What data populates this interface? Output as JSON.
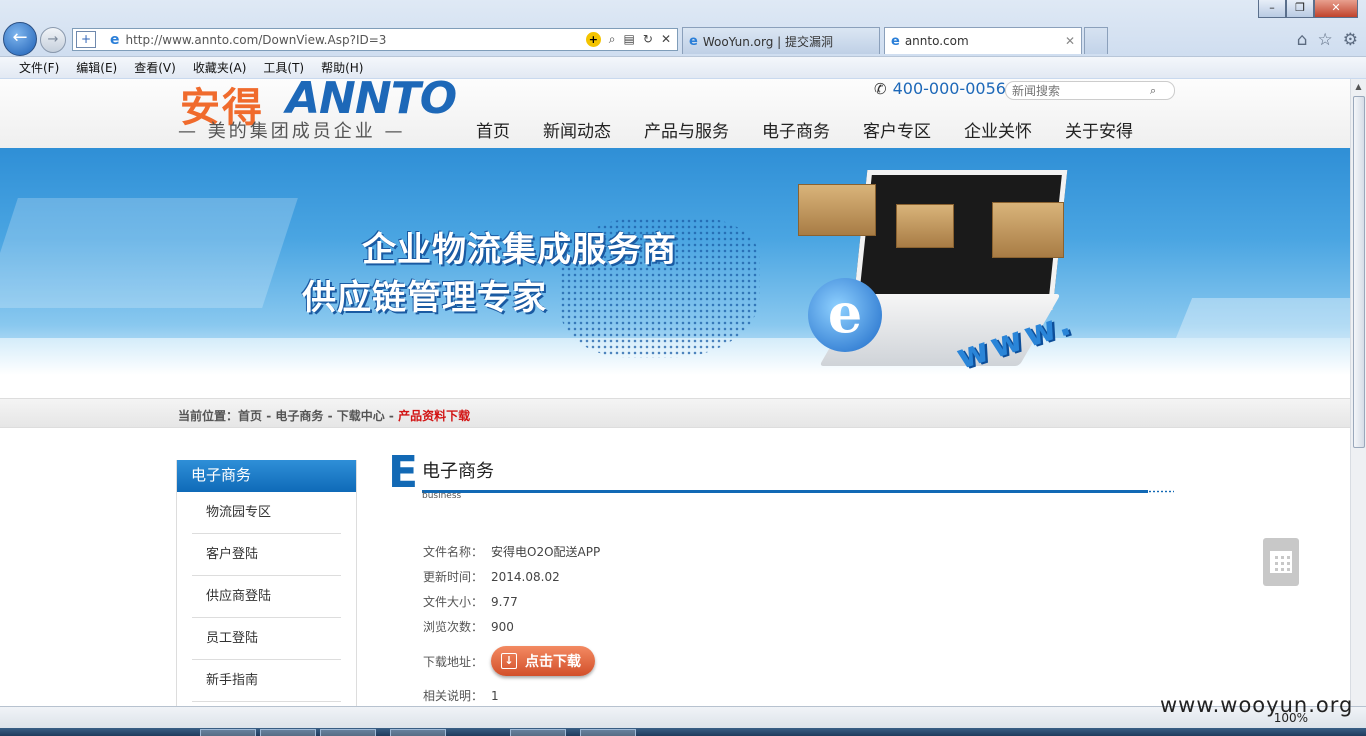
{
  "browser": {
    "url": "http://www.annto.com/DownView.Asp?ID=3",
    "tabs": [
      {
        "label": "WooYun.org | 提交漏洞"
      },
      {
        "label": "annto.com"
      }
    ],
    "menu": [
      "文件(F)",
      "编辑(E)",
      "查看(V)",
      "收藏夹(A)",
      "工具(T)",
      "帮助(H)"
    ],
    "zoom": "100%",
    "icons": [
      "back-icon",
      "forward-icon",
      "refresh-icon",
      "search-icon",
      "home-icon",
      "star-icon",
      "gear-icon"
    ]
  },
  "header": {
    "logo_cn": "安得",
    "logo_en": "ANNTO",
    "logo_tagline": "— 美的集团成员企业 —",
    "phone": "400-000-0056",
    "search_placeholder": "新闻搜索",
    "nav": [
      "首页",
      "新闻动态",
      "产品与服务",
      "电子商务",
      "客户专区",
      "企业关怀",
      "关于安得"
    ]
  },
  "banner": {
    "slogan_line1": "企业物流集成服务商",
    "slogan_line2": "供应链管理专家",
    "ie_letter": "e",
    "www_text": "www."
  },
  "breadcrumb": {
    "prefix": "当前位置：",
    "items": [
      "首页",
      "电子商务",
      "下载中心"
    ],
    "separator": " - ",
    "current": "产品资料下载"
  },
  "sidebar": {
    "title": "电子商务",
    "items": [
      "物流园专区",
      "客户登陆",
      "供应商登陆",
      "员工登陆",
      "新手指南"
    ]
  },
  "content": {
    "big_letter": "E",
    "title": "电子商务",
    "subtitle": "business",
    "fields": [
      {
        "label": "文件名称：",
        "value": "安得电O2O配送APP"
      },
      {
        "label": "更新时间：",
        "value": "2014.08.02"
      },
      {
        "label": "文件大小：",
        "value": "9.77"
      },
      {
        "label": "浏览次数：",
        "value": "900"
      }
    ],
    "download_label": "下载地址：",
    "download_button": "点击下载",
    "note_label": "相关说明：",
    "note_value": "1"
  },
  "watermark": "www.wooyun.org",
  "colors": {
    "brand_blue": "#1269b5",
    "brand_orange": "#f06b2d",
    "current_crumb": "#d21414",
    "download_button": "#d24f2a"
  }
}
